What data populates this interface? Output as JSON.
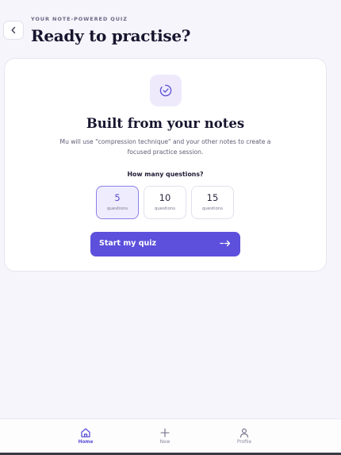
{
  "header": {
    "eyebrow": "YOUR NOTE-POWERED QUIZ",
    "title": "Ready to practise?",
    "back_icon": "chevron-left-icon"
  },
  "card": {
    "icon": "check-circle-icon",
    "title": "Built from your notes",
    "description": "Mu will use \"compression technique\" and your other notes to create a focused practice session.",
    "question_label": "How many questions?",
    "options": [
      {
        "value": "5",
        "unit": "questions",
        "selected": true
      },
      {
        "value": "10",
        "unit": "questions",
        "selected": false
      },
      {
        "value": "15",
        "unit": "questions",
        "selected": false
      }
    ],
    "start_label": "Start my quiz",
    "start_icon": "arrow-right-icon"
  },
  "nav": {
    "items": [
      {
        "label": "Home",
        "icon": "home-icon",
        "active": true
      },
      {
        "label": "New",
        "icon": "plus-icon",
        "active": false
      },
      {
        "label": "Profile",
        "icon": "user-icon",
        "active": false
      }
    ]
  },
  "colors": {
    "accent": "#5c50dc",
    "background": "#f6f5fb",
    "selected_bg": "#efedfd"
  }
}
